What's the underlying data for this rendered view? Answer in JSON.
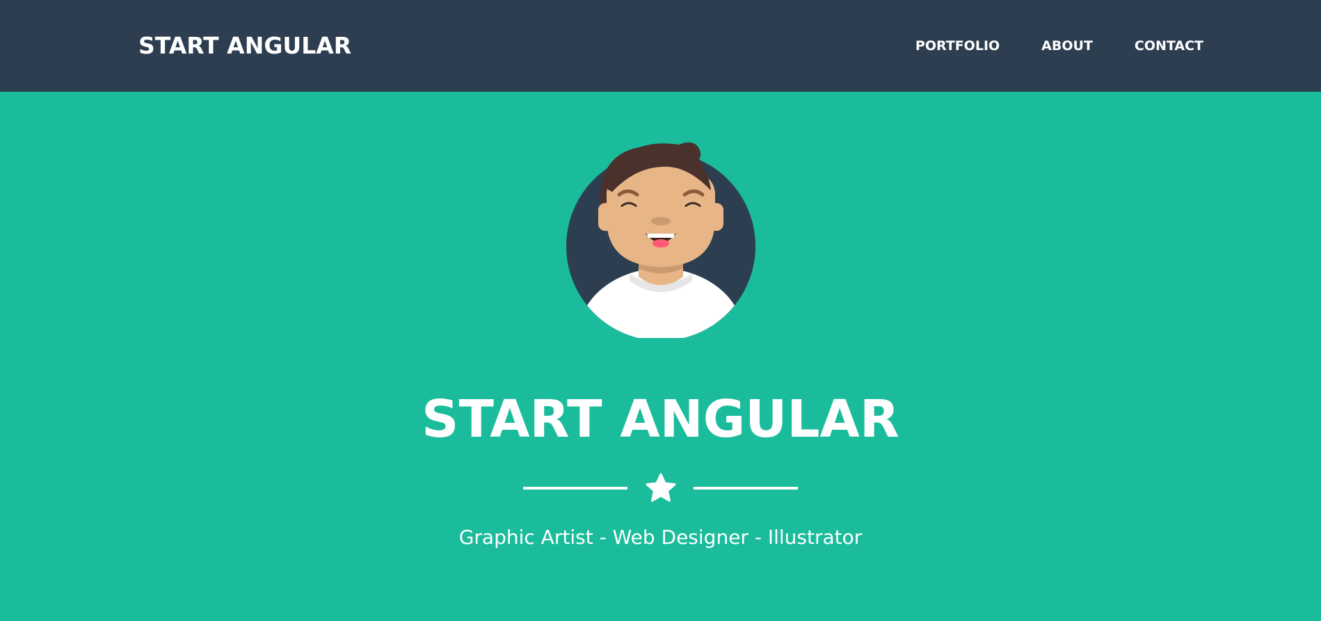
{
  "navbar": {
    "brand": "START ANGULAR",
    "links": [
      {
        "label": "PORTFOLIO"
      },
      {
        "label": "ABOUT"
      },
      {
        "label": "CONTACT"
      }
    ]
  },
  "hero": {
    "avatar_icon": "smiling-person-avatar-icon",
    "title": "START ANGULAR",
    "divider_icon": "star-icon",
    "subtitle": "Graphic Artist - Web Designer - Illustrator"
  },
  "colors": {
    "navbar_bg": "#2c3e50",
    "hero_bg": "#1abc9c",
    "text": "#ffffff"
  }
}
